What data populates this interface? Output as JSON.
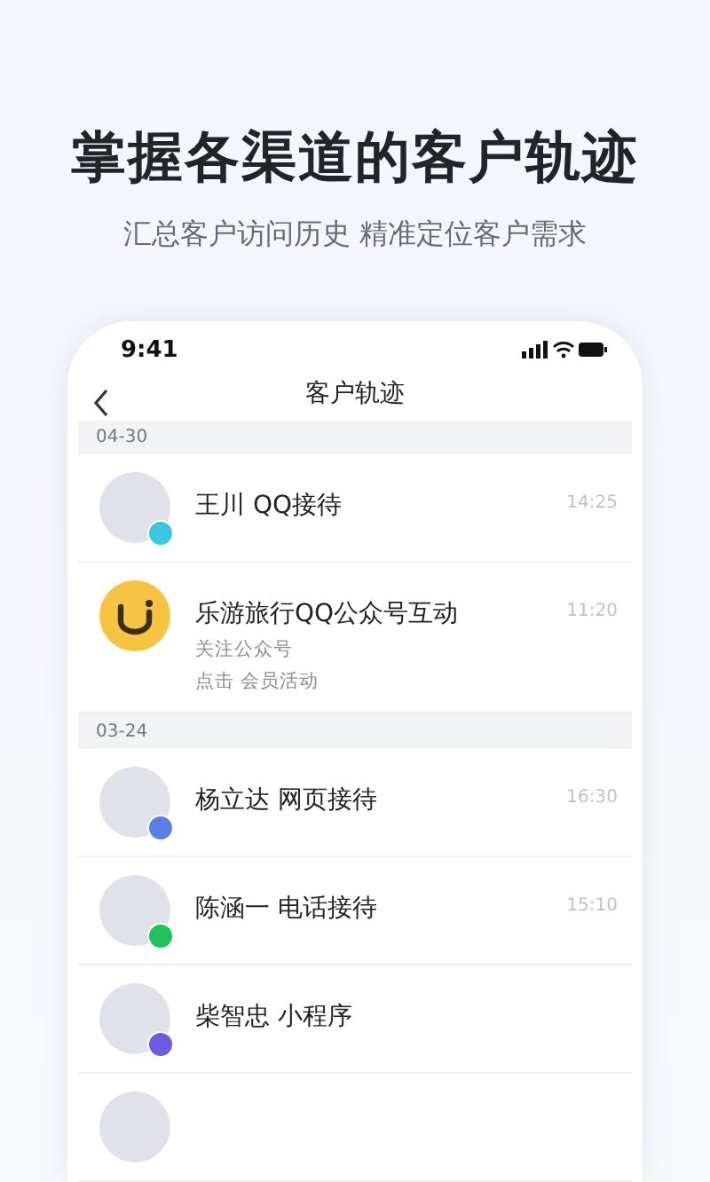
{
  "headline": "掌握各渠道的客户轨迹",
  "subheadline": "汇总客户访问历史 精准定位客户需求",
  "phone": {
    "time": "9:41",
    "title": "客户轨迹",
    "groups": [
      {
        "date": "04-30",
        "rows": [
          {
            "kind": "person",
            "name": "王川 QQ接待",
            "time": "14:25",
            "color": "#3cc6e0"
          },
          {
            "kind": "brand",
            "name": "乐游旅行QQ公众号互动",
            "time": "11:20",
            "details": [
              "关注公众号",
              "点击 会员活动"
            ]
          }
        ]
      },
      {
        "date": "03-24",
        "rows": [
          {
            "kind": "person",
            "name": "杨立达 网页接待",
            "time": "16:30",
            "color": "#5b7fe6"
          },
          {
            "kind": "person",
            "name": "陈涵一 电话接待",
            "time": "15:10",
            "color": "#22c15e"
          },
          {
            "kind": "person",
            "name": "柴智忠 小程序",
            "color": "#6b5fe0"
          },
          {
            "kind": "person"
          }
        ]
      }
    ]
  }
}
